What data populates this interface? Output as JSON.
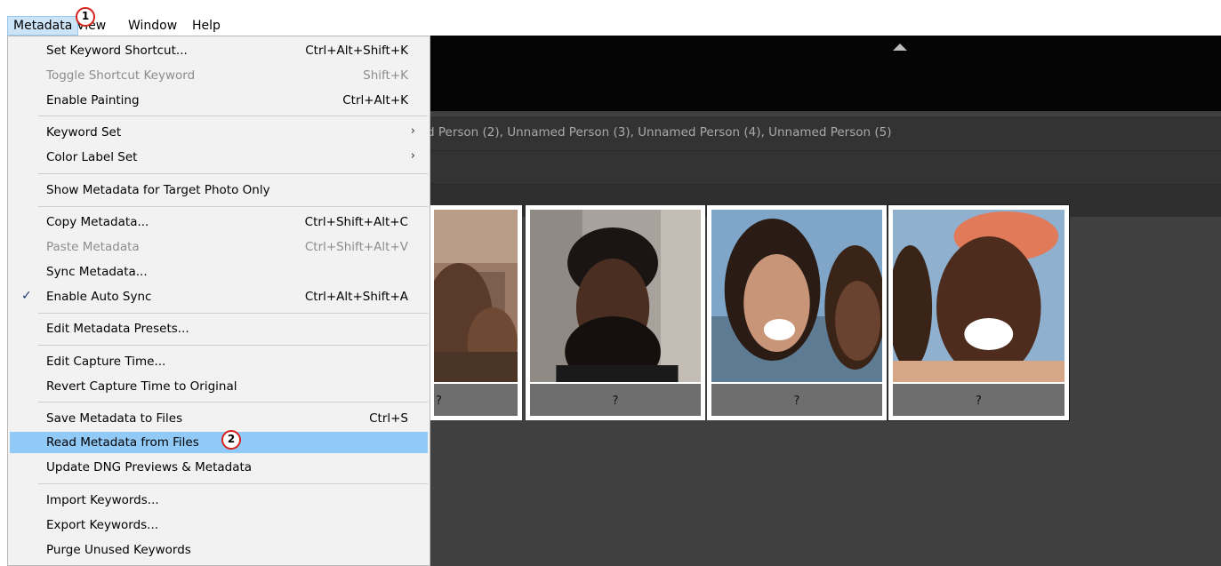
{
  "menubar": {
    "items": [
      {
        "label": "Metadata"
      },
      {
        "label": "View"
      },
      {
        "label": "Window"
      },
      {
        "label": "Help"
      }
    ]
  },
  "menu": {
    "items": [
      {
        "label": "Set Keyword Shortcut...",
        "shortcut": "Ctrl+Alt+Shift+K"
      },
      {
        "label": "Toggle Shortcut Keyword",
        "shortcut": "Shift+K",
        "disabled": true
      },
      {
        "label": "Enable Painting",
        "shortcut": "Ctrl+Alt+K"
      },
      {
        "label": "Keyword Set",
        "submenu": true
      },
      {
        "label": "Color Label Set",
        "submenu": true
      },
      {
        "label": "Show Metadata for Target Photo Only"
      },
      {
        "label": "Copy Metadata...",
        "shortcut": "Ctrl+Shift+Alt+C"
      },
      {
        "label": "Paste Metadata",
        "shortcut": "Ctrl+Shift+Alt+V",
        "disabled": true
      },
      {
        "label": "Sync Metadata..."
      },
      {
        "label": "Enable Auto Sync",
        "shortcut": "Ctrl+Alt+Shift+A",
        "checked": true
      },
      {
        "label": "Edit Metadata Presets..."
      },
      {
        "label": "Edit Capture Time..."
      },
      {
        "label": "Revert Capture Time to Original"
      },
      {
        "label": "Save Metadata to Files",
        "shortcut": "Ctrl+S"
      },
      {
        "label": "Read Metadata from Files",
        "highlighted": true
      },
      {
        "label": "Update DNG Previews & Metadata"
      },
      {
        "label": "Import Keywords..."
      },
      {
        "label": "Export Keywords..."
      },
      {
        "label": "Purge Unused Keywords"
      }
    ],
    "check_glyph": "✓",
    "submenu_glyph": "›"
  },
  "app": {
    "people_line": "d Person (2),  Unnamed Person (3),  Unnamed Person (4),  Unnamed Person (5)",
    "cards": [
      {
        "caption": "?"
      },
      {
        "caption": "?"
      },
      {
        "caption": "?"
      },
      {
        "caption": "?"
      }
    ]
  },
  "annotations": [
    "1",
    "2"
  ],
  "colors": {
    "menu_highlight": "#91c9f7",
    "annotation_ring": "#d6221c",
    "app_background": "#404040"
  },
  "icons": [
    "check-icon",
    "submenu-arrow-icon",
    "collapse-arrow-icon"
  ]
}
